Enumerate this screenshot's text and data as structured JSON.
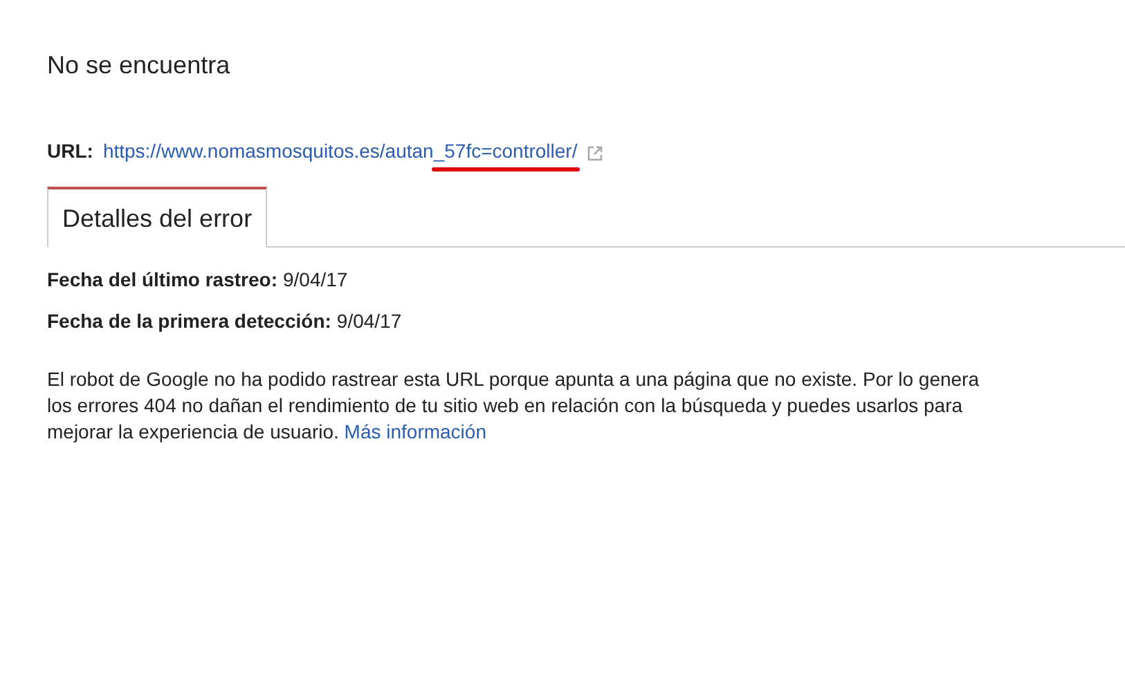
{
  "title": "No se encuentra",
  "url": {
    "label": "URL:",
    "link": "https://www.nomasmosquitos.es/autan_57fc=controller/"
  },
  "tabs": [
    {
      "label": "Detalles del error",
      "selected": true
    }
  ],
  "details": [
    {
      "label": "Fecha del último rastreo:",
      "value": "9/04/17"
    },
    {
      "label": "Fecha de la primera detección:",
      "value": "9/04/17"
    }
  ],
  "description": {
    "lines": [
      "El robot de Google no ha podido rastrear esta URL porque apunta a una página que no existe. Por lo genera",
      "los errores 404 no dañan el rendimiento de tu sitio web en relación con la búsqueda y puedes usarlos para",
      "mejorar la experiencia de usuario."
    ],
    "link": "Más información"
  }
}
